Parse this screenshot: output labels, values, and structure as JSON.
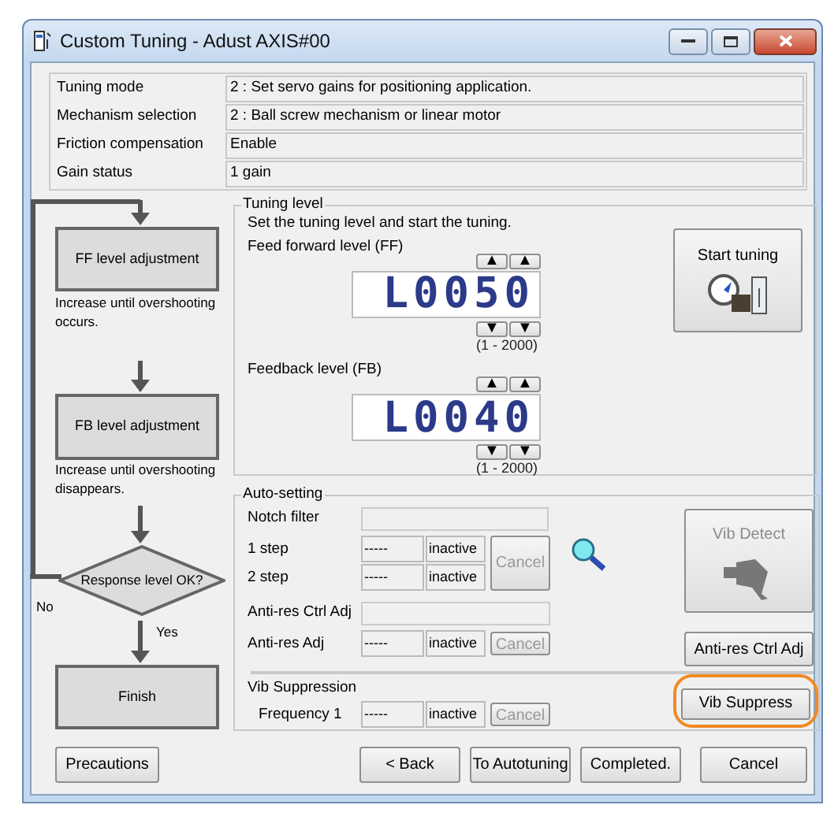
{
  "window": {
    "title": "Custom Tuning - Adust AXIS#00"
  },
  "info_rows": [
    {
      "label": "Tuning mode",
      "value": "2 : Set servo gains for positioning application."
    },
    {
      "label": "Mechanism selection",
      "value": "2 : Ball screw mechanism or linear motor"
    },
    {
      "label": "Friction compensation",
      "value": "Enable"
    },
    {
      "label": "Gain status",
      "value": "1 gain"
    }
  ],
  "flow": {
    "ff_step": "FF level adjustment",
    "ff_note": "Increase until overshooting occurs.",
    "fb_step": "FB level adjustment",
    "fb_note": "Increase until overshooting disappears.",
    "decision": "Response level OK?",
    "no_label": "No",
    "yes_label": "Yes",
    "finish_step": "Finish"
  },
  "tuning_level": {
    "title": "Tuning level",
    "instruction": "Set the tuning level and start the tuning.",
    "levels": [
      {
        "label": "Feed forward level (FF)",
        "value": "L0050",
        "range": "(1 - 2000)",
        "up_buttons": [
          "▲",
          "▲"
        ],
        "down_buttons": [
          "▼",
          "▼"
        ]
      },
      {
        "label": "Feedback level (FB)",
        "value": "L0040",
        "range": "(1 - 2000)",
        "up_buttons": [
          "▲",
          "▲"
        ],
        "down_buttons": [
          "▼",
          "▼"
        ]
      }
    ],
    "start_button": "Start tuning"
  },
  "auto_setting": {
    "title": "Auto-setting",
    "notch_filter": "Notch filter",
    "steps": [
      {
        "label": "1 step",
        "value": "-----",
        "status": "inactive"
      },
      {
        "label": "2 step",
        "value": "-----",
        "status": "inactive"
      }
    ],
    "steps_cancel": {
      "label": "Cancel",
      "disabled": true
    },
    "anti_res_ctrl_label": "Anti-res Ctrl Adj",
    "anti_res_adj": {
      "label": "Anti-res Adj",
      "value": "-----",
      "status": "inactive",
      "cancel": "Cancel",
      "cancel_disabled": true
    },
    "vib_suppression_title": "Vib Suppression",
    "frequency": {
      "label": "Frequency 1",
      "value": "-----",
      "status": "inactive",
      "cancel": "Cancel",
      "cancel_disabled": true
    },
    "vib_detect": {
      "label": "Vib Detect",
      "disabled": true
    },
    "anti_res_button": "Anti-res Ctrl Adj",
    "vib_suppress": {
      "label": "Vib Suppress",
      "highlighted": true
    }
  },
  "footer_buttons": [
    {
      "label": "Precautions",
      "kind": "left"
    },
    {
      "label": "< Back",
      "kind": "right"
    },
    {
      "label": "To Autotuning",
      "kind": "right"
    },
    {
      "label": "Completed.",
      "kind": "right"
    },
    {
      "label": "Cancel",
      "kind": "far"
    }
  ]
}
